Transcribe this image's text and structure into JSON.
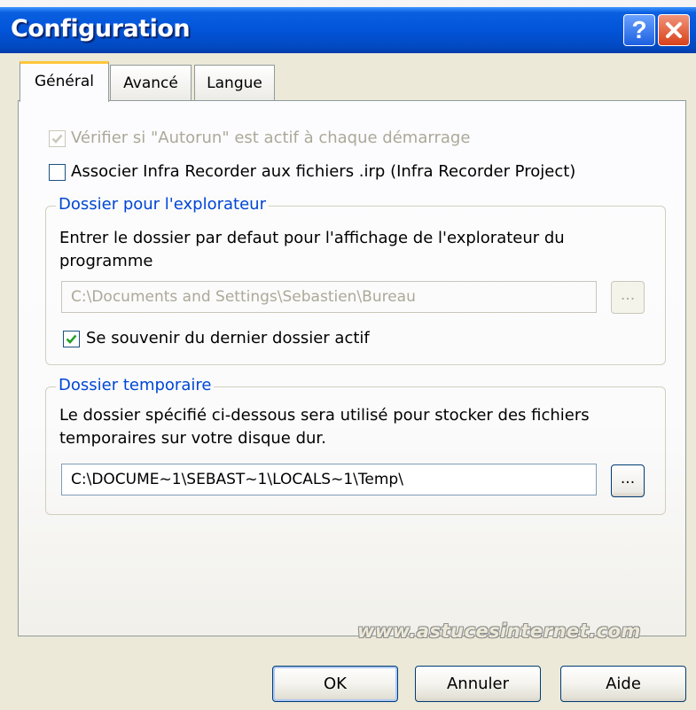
{
  "window": {
    "title": "Configuration",
    "help_symbol": "?"
  },
  "tabs": [
    {
      "label": "Général",
      "selected": true
    },
    {
      "label": "Avancé",
      "selected": false
    },
    {
      "label": "Langue",
      "selected": false
    }
  ],
  "general": {
    "autorun_check": {
      "label": "Vérifier si \"Autorun\" est actif à chaque démarrage",
      "checked": true,
      "enabled": false
    },
    "associate_check": {
      "label": "Associer Infra Recorder aux fichiers .irp (Infra Recorder Project)",
      "checked": false,
      "enabled": true
    },
    "explorer_group": {
      "title": "Dossier pour l'explorateur",
      "description_line1": "Entrer le dossier par defaut pour l'affichage de l'explorateur du",
      "description_line2": "programme",
      "path_value": "C:\\Documents and Settings\\Sebastien\\Bureau",
      "path_enabled": false,
      "browse_label": "...",
      "remember_check": {
        "label": "Se souvenir du dernier dossier actif",
        "checked": true
      }
    },
    "temp_group": {
      "title": "Dossier temporaire",
      "description_line1": "Le dossier spécifié ci-dessous sera utilisé pour stocker des fichiers",
      "description_line2": "temporaires sur votre disque dur.",
      "path_value": "C:\\DOCUME~1\\SEBAST~1\\LOCALS~1\\Temp\\",
      "browse_label": "..."
    }
  },
  "watermark": "www.astucesinternet.com",
  "buttons": {
    "ok": "OK",
    "cancel": "Annuler",
    "help": "Aide"
  },
  "colors": {
    "titlebar": "#0254d9",
    "group_title": "#0046d5",
    "tab_highlight": "#ffc73c",
    "checkmark": "#21a121"
  }
}
